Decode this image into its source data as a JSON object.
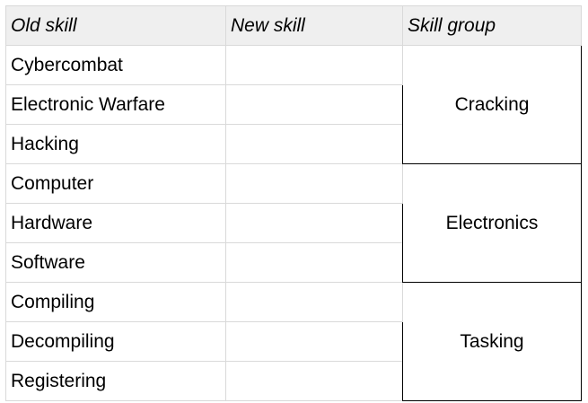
{
  "table": {
    "headers": [
      "Old skill",
      "New skill",
      "Skill group"
    ],
    "groups": [
      {
        "name": "Cracking",
        "old_skills": [
          "Cybercombat",
          "Electronic Warfare",
          "Hacking"
        ],
        "new_skills": [
          "",
          "",
          ""
        ]
      },
      {
        "name": "Electronics",
        "old_skills": [
          "Computer",
          "Hardware",
          "Software"
        ],
        "new_skills": [
          "",
          "",
          ""
        ]
      },
      {
        "name": "Tasking",
        "old_skills": [
          "Compiling",
          "Decompiling",
          "Registering"
        ],
        "new_skills": [
          "",
          "",
          ""
        ]
      }
    ]
  },
  "colors": {
    "header_bg": "#efefef",
    "grid_line": "#d9d9d9",
    "group_border": "#000000"
  }
}
